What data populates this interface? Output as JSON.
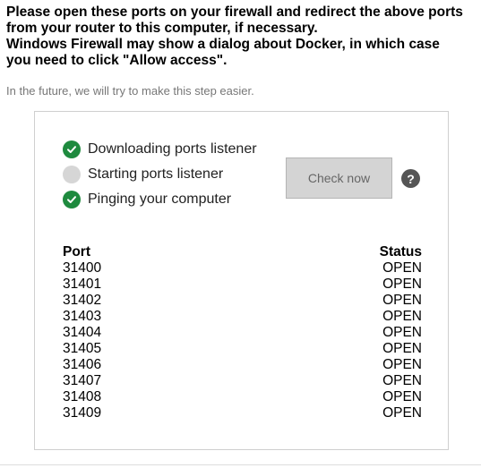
{
  "instructions": {
    "lines": [
      "Please open these ports on your firewall and redirect the above ports",
      "from your router to this computer, if necessary.",
      "Windows Firewall may show a dialog about Docker, in which case",
      "you need to click \"Allow access\"."
    ],
    "note": "In the future, we will try to make this step easier."
  },
  "steps": [
    {
      "label": "Downloading ports listener",
      "status": "done",
      "icon": "check-circle-icon"
    },
    {
      "label": "Starting ports listener",
      "status": "pending",
      "icon": "pending-circle-icon"
    },
    {
      "label": "Pinging your computer",
      "status": "done",
      "icon": "check-circle-icon"
    }
  ],
  "check_button_label": "Check now",
  "help_icon_glyph": "?",
  "ports_table": {
    "headers": {
      "port": "Port",
      "status": "Status"
    },
    "rows": [
      {
        "port": "31400",
        "status": "OPEN"
      },
      {
        "port": "31401",
        "status": "OPEN"
      },
      {
        "port": "31402",
        "status": "OPEN"
      },
      {
        "port": "31403",
        "status": "OPEN"
      },
      {
        "port": "31404",
        "status": "OPEN"
      },
      {
        "port": "31405",
        "status": "OPEN"
      },
      {
        "port": "31406",
        "status": "OPEN"
      },
      {
        "port": "31407",
        "status": "OPEN"
      },
      {
        "port": "31408",
        "status": "OPEN"
      },
      {
        "port": "31409",
        "status": "OPEN"
      }
    ]
  },
  "colors": {
    "success": "#1e8a3e",
    "pending": "#d6d6d6",
    "button_bg": "#d4d4d4",
    "help_bg": "#555555"
  }
}
